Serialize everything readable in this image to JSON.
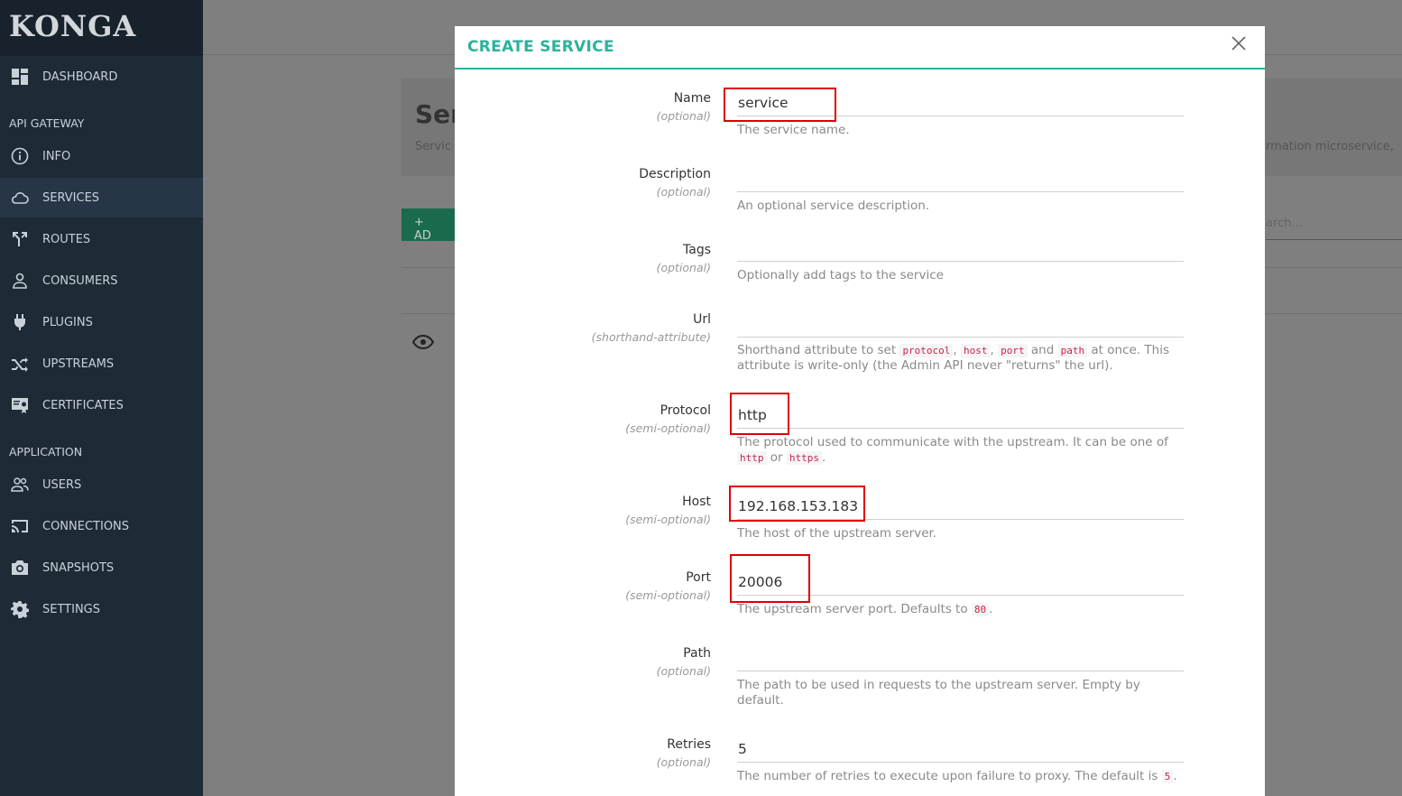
{
  "app": {
    "logo": "KONGA"
  },
  "sidebar": {
    "dashboard": "DASHBOARD",
    "section_api": "API GATEWAY",
    "info": "INFO",
    "services": "SERVICES",
    "routes": "ROUTES",
    "consumers": "CONSUMERS",
    "plugins": "PLUGINS",
    "upstreams": "UPSTREAMS",
    "certificates": "CERTIFICATES",
    "section_app": "APPLICATION",
    "users": "USERS",
    "connections": "CONNECTIONS",
    "snapshots": "SNAPSHOTS",
    "settings": "SETTINGS"
  },
  "background": {
    "title": "Ser",
    "subtitle": "Servic",
    "subtitle_right": "rmation microservice,",
    "add_button": "+ AD",
    "search": "arch..."
  },
  "modal": {
    "title": "CREATE SERVICE",
    "fields": {
      "name": {
        "label": "Name",
        "hint": "(optional)",
        "value": "service",
        "help": "The service name."
      },
      "description": {
        "label": "Description",
        "hint": "(optional)",
        "value": "",
        "help": "An optional service description."
      },
      "tags": {
        "label": "Tags",
        "hint": "(optional)",
        "value": "",
        "help": "Optionally add tags to the service"
      },
      "url": {
        "label": "Url",
        "hint": "(shorthand-attribute)",
        "value": "",
        "help_a": "Shorthand attribute to set",
        "code_protocol": "protocol",
        "sep1": ",",
        "code_host": "host",
        "sep2": ",",
        "code_port": "port",
        "and": "and",
        "code_path": "path",
        "help_b": "at once. This attribute is write-only (the Admin API never \"returns\" the url)."
      },
      "protocol": {
        "label": "Protocol",
        "hint": "(semi-optional)",
        "value": "http",
        "help_a": "The protocol used to communicate with the upstream. It can be one of",
        "code_http": "http",
        "or": "or",
        "code_https": "https",
        "end": "."
      },
      "host": {
        "label": "Host",
        "hint": "(semi-optional)",
        "value": "192.168.153.183",
        "help": "The host of the upstream server."
      },
      "port": {
        "label": "Port",
        "hint": "(semi-optional)",
        "value": "20006",
        "help_a": "The upstream server port. Defaults to",
        "code_default": "80",
        "end": "."
      },
      "path": {
        "label": "Path",
        "hint": "(optional)",
        "value": "",
        "help": "The path to be used in requests to the upstream server. Empty by default."
      },
      "retries": {
        "label": "Retries",
        "hint": "(optional)",
        "value": "5",
        "help_a": "The number of retries to execute upon failure to proxy. The default is",
        "code_default": "5",
        "end": "."
      }
    }
  },
  "colors": {
    "accent": "#2cb39a",
    "sidebar_bg": "#1e2a36",
    "highlight": "#e00000"
  }
}
